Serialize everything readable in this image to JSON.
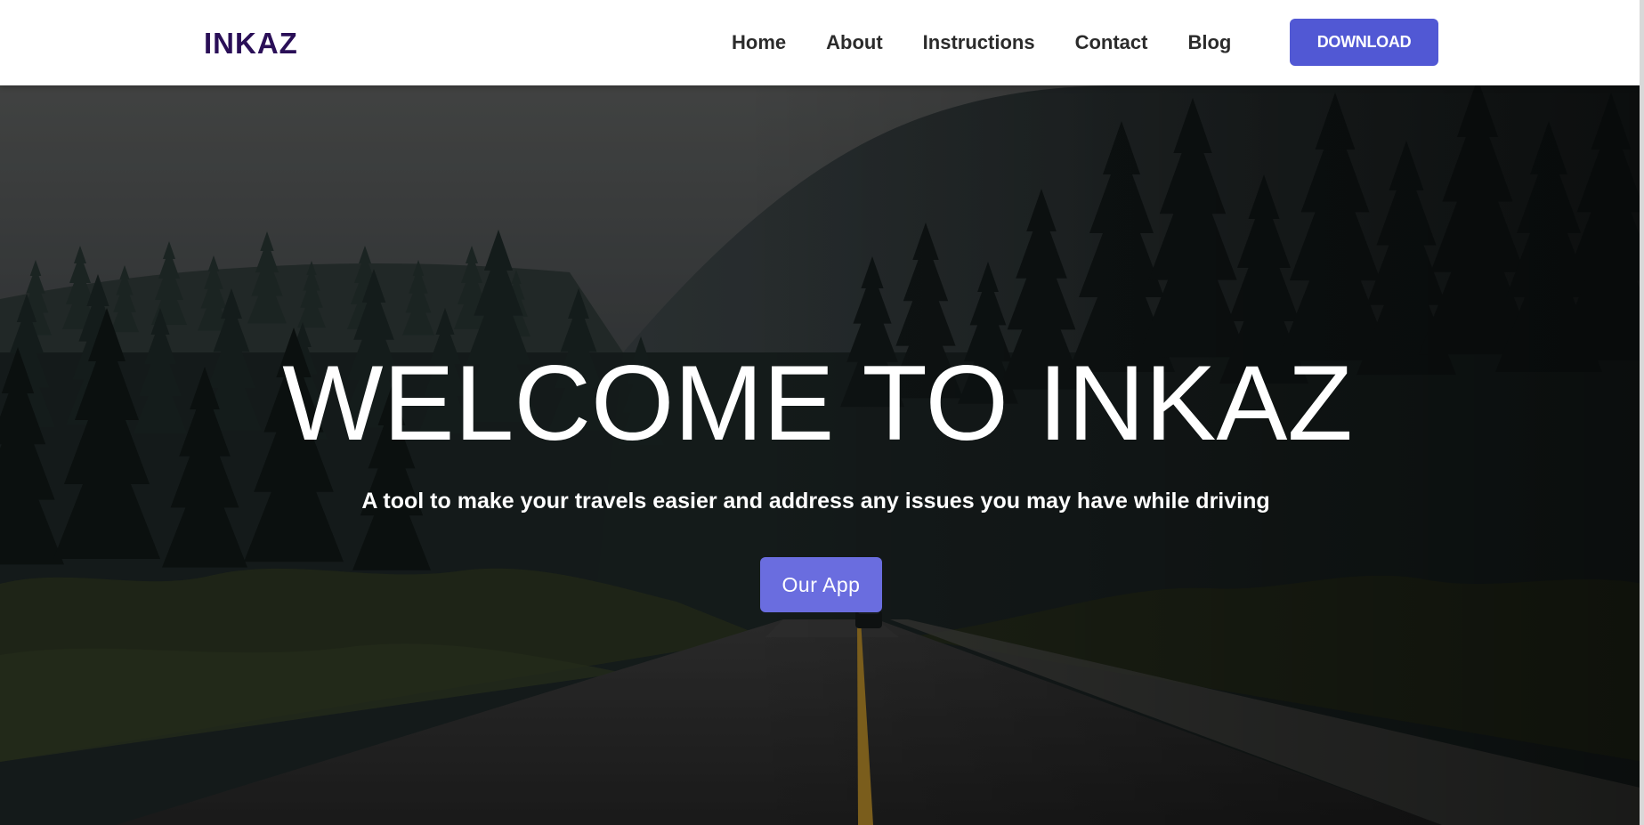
{
  "brand": {
    "name": "INKAZ",
    "color": "#2a0f57"
  },
  "nav": {
    "links": [
      "Home",
      "About",
      "Instructions",
      "Contact",
      "Blog"
    ],
    "download_label": "DOWNLOAD"
  },
  "hero": {
    "title": "WELCOME TO INKAZ",
    "subtitle": "A tool to make your travels easier and address any issues you may have while driving",
    "cta_label": "Our App",
    "background_image": "forest road with car"
  },
  "colors": {
    "download_button": "#5158d4",
    "cta_button": "#6a6ddf",
    "nav_text": "#2b2b2b"
  }
}
